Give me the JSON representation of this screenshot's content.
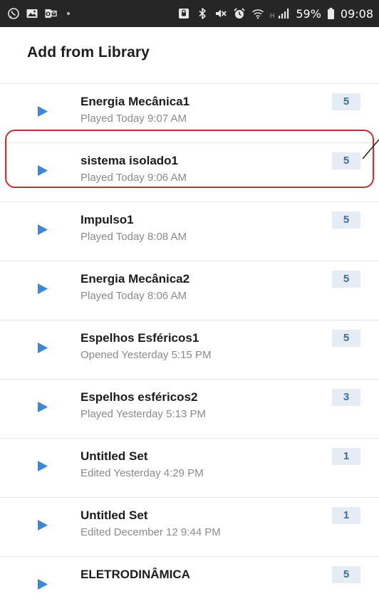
{
  "status_bar": {
    "left_icons": [
      "whatsapp-icon",
      "gallery-icon",
      "outlook-icon"
    ],
    "right_icons": [
      "nfc-icon",
      "bluetooth-icon",
      "mute-icon",
      "alarm-icon",
      "wifi-icon",
      "signal-icon",
      "battery-icon"
    ],
    "network_type": "H",
    "battery": "59%",
    "time": "09:08"
  },
  "header": {
    "title": "Add from Library"
  },
  "sets": [
    {
      "title": "Energia Mecânica1",
      "subtitle": "Played Today 9:07 AM",
      "count": "5",
      "icon": "play-icon"
    },
    {
      "title": "sistema isolado1",
      "subtitle": "Played Today 9:06 AM",
      "count": "5",
      "icon": "play-icon"
    },
    {
      "title": "Impulso1",
      "subtitle": "Played Today 8:08 AM",
      "count": "5",
      "icon": "play-icon"
    },
    {
      "title": "Energia Mecânica2",
      "subtitle": "Played Today 8:06 AM",
      "count": "5",
      "icon": "play-icon"
    },
    {
      "title": "Espelhos Esféricos1",
      "subtitle": "Opened Yesterday 5:15 PM",
      "count": "5",
      "icon": "play-icon"
    },
    {
      "title": "Espelhos esféricos2",
      "subtitle": "Played Yesterday 5:13 PM",
      "count": "3",
      "icon": "play-icon"
    },
    {
      "title": "Untitled Set",
      "subtitle": "Edited Yesterday 4:29 PM",
      "count": "1",
      "icon": "play-icon"
    },
    {
      "title": "Untitled Set",
      "subtitle": "Edited December 12 9:44 PM",
      "count": "1",
      "icon": "play-icon"
    },
    {
      "title": "ELETRODINÂMICA",
      "subtitle": "",
      "count": "5",
      "icon": "play-icon"
    }
  ],
  "colors": {
    "status_bar_bg": "#262626",
    "play_icon": "#3a86e0",
    "badge_bg": "#e5ecf4",
    "badge_text": "#3b6ea5",
    "highlight": "#d12d2d"
  }
}
